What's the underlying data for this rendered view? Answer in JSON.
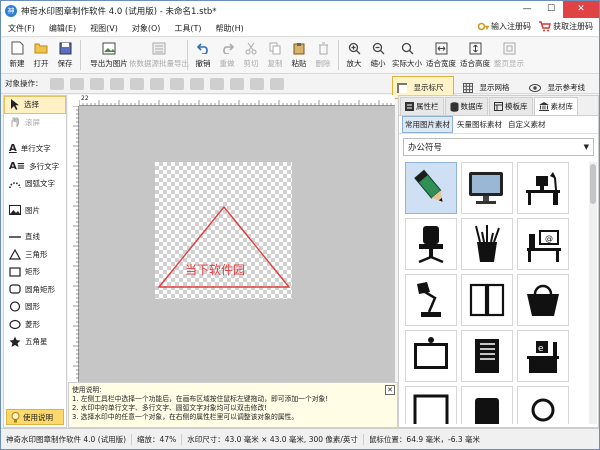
{
  "window": {
    "title": "神奇水印图章制作软件 4.0 (试用版) - 未命名1.stb*",
    "app_icon": "神"
  },
  "menu": {
    "items": [
      "文件(F)",
      "编辑(E)",
      "视图(V)",
      "对象(O)",
      "工具(T)",
      "帮助(H)"
    ],
    "register": "输入注册码",
    "buy": "获取注册码"
  },
  "toolbar": {
    "items": [
      {
        "label": "新建",
        "icon": "new-file-icon"
      },
      {
        "label": "打开",
        "icon": "open-folder-icon"
      },
      {
        "label": "保存",
        "icon": "save-icon"
      },
      {
        "label": "导出为图片",
        "icon": "export-image-icon"
      },
      {
        "label": "依数据源批量导出",
        "icon": "batch-export-icon",
        "disabled": true
      },
      {
        "label": "撤销",
        "icon": "undo-icon"
      },
      {
        "label": "重做",
        "icon": "redo-icon",
        "disabled": true
      },
      {
        "label": "剪切",
        "icon": "cut-icon",
        "disabled": true
      },
      {
        "label": "复制",
        "icon": "copy-icon",
        "disabled": true
      },
      {
        "label": "粘贴",
        "icon": "paste-icon"
      },
      {
        "label": "删除",
        "icon": "delete-icon",
        "disabled": true
      },
      {
        "label": "放大",
        "icon": "zoom-in-icon"
      },
      {
        "label": "缩小",
        "icon": "zoom-out-icon"
      },
      {
        "label": "实际大小",
        "icon": "actual-size-icon"
      },
      {
        "label": "适合宽度",
        "icon": "fit-width-icon"
      },
      {
        "label": "适合高度",
        "icon": "fit-height-icon"
      },
      {
        "label": "整页显示",
        "icon": "whole-page-icon",
        "disabled": true
      }
    ]
  },
  "opbar": {
    "label": "对象操作：",
    "show_ruler": "显示标尺",
    "show_grid": "显示网格",
    "show_guides": "显示参考线"
  },
  "tools": [
    {
      "label": "选择",
      "icon": "pointer-icon",
      "selected": true
    },
    {
      "label": "滚屏",
      "icon": "hand-icon",
      "disabled": true
    },
    {
      "label": "单行文字",
      "icon": "single-text-icon"
    },
    {
      "label": "多行文字",
      "icon": "multi-text-icon"
    },
    {
      "label": "圆弧文字",
      "icon": "arc-text-icon"
    },
    {
      "label": "图片",
      "icon": "image-icon"
    },
    {
      "label": "直线",
      "icon": "line-icon"
    },
    {
      "label": "三角形",
      "icon": "triangle-icon"
    },
    {
      "label": "矩形",
      "icon": "rectangle-icon"
    },
    {
      "label": "圆角矩形",
      "icon": "rounded-rect-icon"
    },
    {
      "label": "圆形",
      "icon": "circle-icon"
    },
    {
      "label": "菱形",
      "icon": "diamond-icon"
    },
    {
      "label": "五角星",
      "icon": "star-icon"
    }
  ],
  "help_button": "使用说明",
  "ruler": {
    "top_first": "22"
  },
  "canvas": {
    "watermark_text": "当下软件园"
  },
  "help": {
    "title": "使用说明:",
    "lines": [
      "1. 左侧工具栏中选择一个功能后，在画布区域按住鼠标左键拖动，即可添加一个对象!",
      "2. 水印中的单行文字、多行文字、圆弧文字对象均可以双击修改!",
      "3. 选择水印中的任意一个对象，在右侧的属性栏里可以调整该对象的属性。"
    ]
  },
  "right": {
    "tabs": [
      "属性栏",
      "数据库",
      "模板库",
      "素材库"
    ],
    "subtabs": [
      "常用图片素材",
      "矢量图标素材",
      "自定义素材"
    ],
    "category": "办公符号"
  },
  "status": {
    "app": "神奇水印图章制作软件 4.0 (试用版)",
    "zoom": "缩放：47%",
    "size": "水印尺寸：43.0 毫米 × 43.0 毫米, 300 像素/英寸",
    "mouse": "鼠标位置：64.9 毫米，-6.3 毫米"
  }
}
